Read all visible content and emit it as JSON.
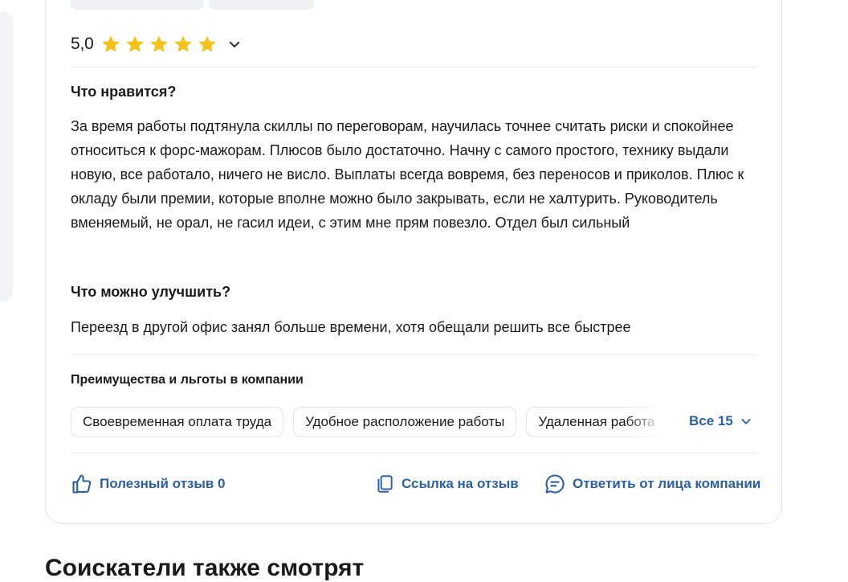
{
  "review": {
    "rating": {
      "value": "5,0",
      "stars": 5,
      "max_stars": 5,
      "star_color": "#f7c21a"
    },
    "likes": {
      "title": "Что нравится?",
      "text": "За время работы подтянула скиллы по переговорам, научилась точнее считать риски и спокойнее относиться к форс-мажорам. Плюсов было достаточно. Начну с самого простого, технику выдали новую, все работало, ничего не висло. Выплаты всегда вовремя, без переносов и приколов. Плюс к окладу были премии, которые вполне можно было закрывать, если не халтурить. Руководитель вменяемый, не орал, не гасил идеи, с этим мне прям повезло. Отдел был сильный"
    },
    "improve": {
      "title": "Что можно улучшить?",
      "text": "Переезд в другой офис занял больше времени, хотя обещали решить все быстрее"
    },
    "benefits": {
      "title": "Преимущества и льготы в компании",
      "items": [
        "Своевременная оплата труда",
        "Удобное расположение работы",
        "Удаленная работа"
      ],
      "all_label": "Все 15"
    },
    "actions": {
      "helpful": "Полезный отзыв 0",
      "link": "Ссылка на отзыв",
      "reply": "Ответить от лица компании"
    }
  },
  "bottom_heading": "Соискатели также смотрят",
  "colors": {
    "accent": "#2b5fa8",
    "star": "#f7c21a",
    "border": "#e4e6ea"
  }
}
